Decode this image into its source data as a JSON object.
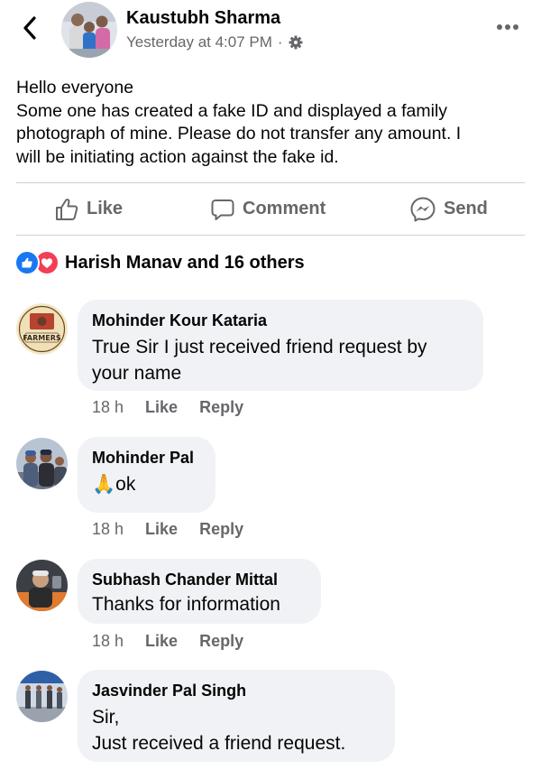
{
  "post": {
    "author": "Kaustubh Sharma",
    "timestamp": "Yesterday at 4:07 PM",
    "separator": "·",
    "privacy_icon": "gear-icon",
    "lines": [
      "Hello everyone",
      "Some one has created a fake ID and displayed a family",
      "photograph of mine. Please do not transfer any amount. I",
      "will be initiating action against the fake id."
    ]
  },
  "actions": {
    "like": "Like",
    "comment": "Comment",
    "send": "Send"
  },
  "reactions": {
    "text": "Harish Manav and 16 others",
    "icons": [
      "like-reaction-icon",
      "love-reaction-icon"
    ]
  },
  "comments": [
    {
      "name": "Mohinder Kour Kataria",
      "lines": [
        "True Sir I just received friend request by",
        "your name"
      ],
      "time": "18 h",
      "like": "Like",
      "reply": "Reply",
      "avatar_badge": "FARMERS"
    },
    {
      "name": "Mohinder Pal",
      "emoji": "🙏",
      "lines": [
        "ok"
      ],
      "time": "18 h",
      "like": "Like",
      "reply": "Reply"
    },
    {
      "name": "Subhash Chander Mittal",
      "lines": [
        "Thanks for information"
      ],
      "time": "18 h",
      "like": "Like",
      "reply": "Reply"
    },
    {
      "name": "Jasvinder Pal Singh",
      "lines": [
        "Sir,",
        "Just received a friend request."
      ]
    }
  ],
  "colors": {
    "facebook_blue": "#1877f2",
    "love_red": "#f33e58",
    "secondary_text": "#65676b",
    "bubble_bg": "#f0f2f5"
  }
}
